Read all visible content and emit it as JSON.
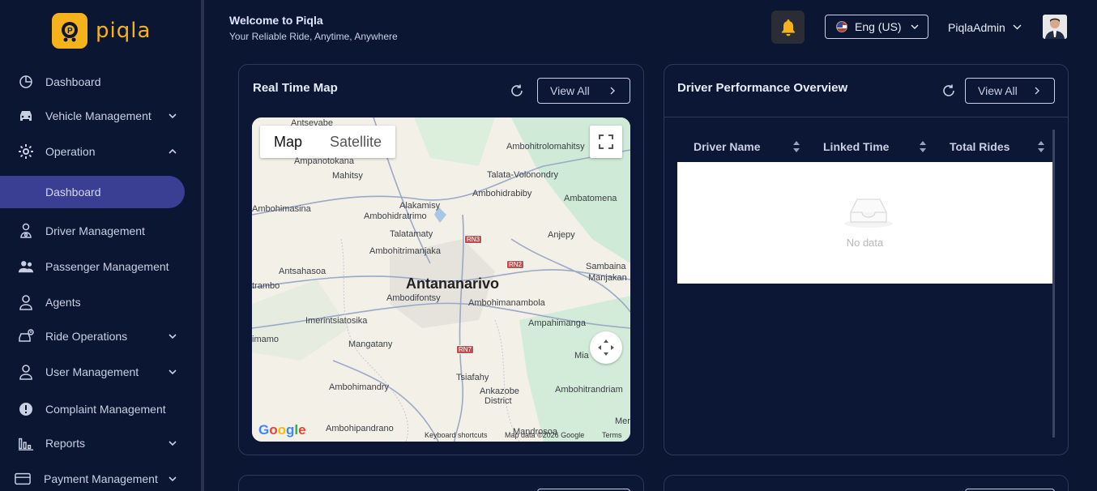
{
  "brand": {
    "name": "piqla"
  },
  "header": {
    "welcome": "Welcome to Piqla",
    "tagline": "Your Reliable Ride, Anytime, Anywhere",
    "language": "Eng (US)",
    "user_name": "PiqlaAdmin"
  },
  "sidebar": {
    "items": [
      {
        "label": "Dashboard",
        "icon": "dashboard-icon"
      },
      {
        "label": "Vehicle Management",
        "icon": "car-icon",
        "expandable": true
      },
      {
        "label": "Operation",
        "icon": "gear-icon",
        "expanded": true
      },
      {
        "label": "Dashboard",
        "active": true
      },
      {
        "label": "Driver Management",
        "icon": "driver-icon"
      },
      {
        "label": "Passenger Management",
        "icon": "users-icon"
      },
      {
        "label": "Agents",
        "icon": "user-icon"
      },
      {
        "label": "Ride Operations",
        "icon": "ride-icon",
        "expandable": true
      },
      {
        "label": "User Management",
        "icon": "user-icon",
        "expandable": true
      },
      {
        "label": "Complaint Management",
        "icon": "alert-icon"
      },
      {
        "label": "Reports",
        "icon": "bar-chart-icon",
        "expandable": true
      },
      {
        "label": "Payment Management",
        "icon": "card-icon",
        "expandable": true
      }
    ]
  },
  "map_card": {
    "title": "Real Time Map",
    "view_all": "View All",
    "tabs": [
      "Map",
      "Satellite"
    ],
    "city": "Antananarivo",
    "places": [
      "Antsevabe",
      "Ambohitrolomahitsy",
      "Ampanotokana",
      "Mahitsy",
      "Talata-Volonondry",
      "Alakamisy",
      "Ambohidrabiby",
      "Ambatomena",
      "Ambohimasina",
      "Ambohidratrimo",
      "Talatamaty",
      "Anjepy",
      "Ambohitrimanjaka",
      "Antsahasoa",
      "Sambaina",
      "Manjakan",
      "trambo",
      "Ambodifontsy",
      "Ambohimanambola",
      "Imerintsiatosika",
      "Ampahimanga",
      "imamo",
      "Mangatany",
      "Mia",
      "Tsiafahy",
      "Ambohimandry",
      "Ankazobe",
      "District",
      "Ambohitrandriam",
      "Ambohipandrano",
      "Mandrosoa",
      "Mer"
    ],
    "roads": [
      "RN3",
      "RN2",
      "RN7"
    ],
    "attribution": {
      "shortcuts": "Keyboard shortcuts",
      "data": "Map data ©2026 Google",
      "terms": "Terms"
    },
    "google": "Google"
  },
  "driver_card": {
    "title": "Driver Performance Overview",
    "view_all": "View All",
    "columns": [
      "Driver Name",
      "Linked Time",
      "Total Rides"
    ],
    "empty_text": "No data"
  },
  "colors": {
    "accent": "#3a3f94",
    "brand": "#f6b21b",
    "background": "#0b1633"
  }
}
